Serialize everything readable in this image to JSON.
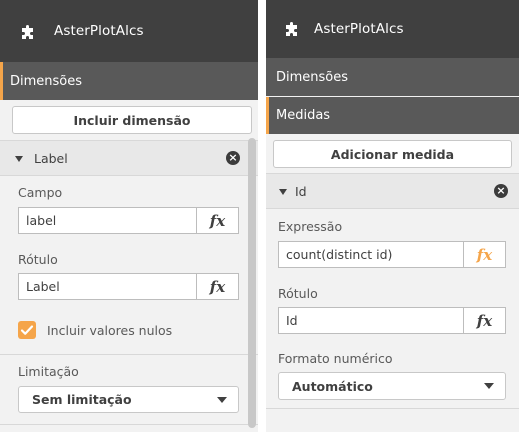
{
  "left_panel": {
    "header_title": "AsterPlotAlcs",
    "dimensions_label": "Dimensões",
    "add_dimension_button": "Incluir dimensão",
    "item_label": "Label",
    "field_label": "Campo",
    "field_value": "label",
    "label_label": "Rótulo",
    "label_value": "Label",
    "fx_label": "fx",
    "include_nulls_label": "Incluir valores nulos",
    "include_nulls_checked": true,
    "limitation_label": "Limitação",
    "limitation_value": "Sem limitação"
  },
  "right_panel": {
    "header_title": "AsterPlotAlcs",
    "dimensions_label": "Dimensões",
    "measures_label": "Medidas",
    "add_measure_button": "Adicionar medida",
    "item_label": "Id",
    "expression_label": "Expressão",
    "expression_value": "count(distinct id)",
    "label_label": "Rótulo",
    "label_value": "Id",
    "fx_label": "fx",
    "number_format_label": "Formato numérico",
    "number_format_value": "Automático"
  },
  "colors": {
    "header_bg": "#404040",
    "section_bg": "#595959",
    "accent": "#f5a54a",
    "panel_bg": "#f2f2f2"
  }
}
